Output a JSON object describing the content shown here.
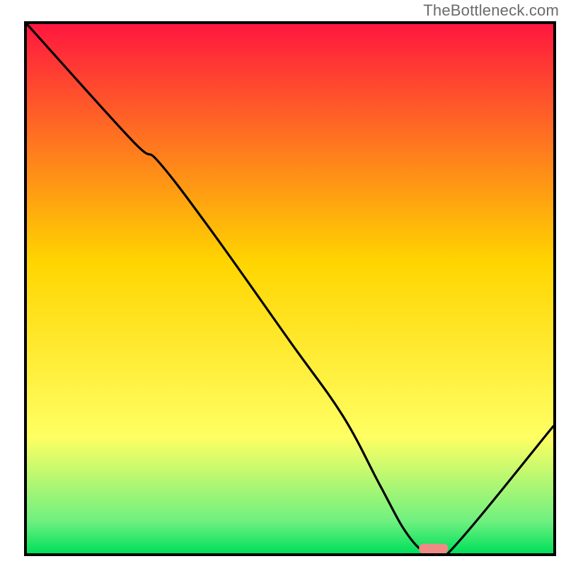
{
  "watermark": "TheBottleneck.com",
  "colors": {
    "border": "#000000",
    "grad_top": "#ff173f",
    "grad_mid": "#ffd500",
    "grad_yel": "#ffff63",
    "grad_grn1": "#6ef080",
    "grad_grn2": "#00e05b",
    "curve": "#000000",
    "marker_fill": "#f08a87",
    "marker_stroke": "#f08a87"
  },
  "chart_data": {
    "type": "line",
    "x": [
      0.0,
      0.2,
      0.25,
      0.35,
      0.5,
      0.6,
      0.67,
      0.72,
      0.76,
      0.8,
      1.0
    ],
    "values": [
      1.0,
      0.78,
      0.74,
      0.61,
      0.4,
      0.26,
      0.13,
      0.04,
      0.0,
      0.0,
      0.24
    ],
    "ylim": [
      0,
      1
    ],
    "xlim": [
      0,
      1
    ],
    "xlabel": "",
    "ylabel": "",
    "title": "",
    "marker": {
      "x0": 0.745,
      "x1": 0.8,
      "y": 0.006,
      "shape": "rounded-bar"
    },
    "gradient_stops_pct": [
      {
        "offset": 0,
        "key": "grad_top"
      },
      {
        "offset": 45,
        "key": "grad_mid"
      },
      {
        "offset": 78,
        "key": "grad_yel"
      },
      {
        "offset": 94,
        "key": "grad_grn1"
      },
      {
        "offset": 100,
        "key": "grad_grn2"
      }
    ]
  }
}
